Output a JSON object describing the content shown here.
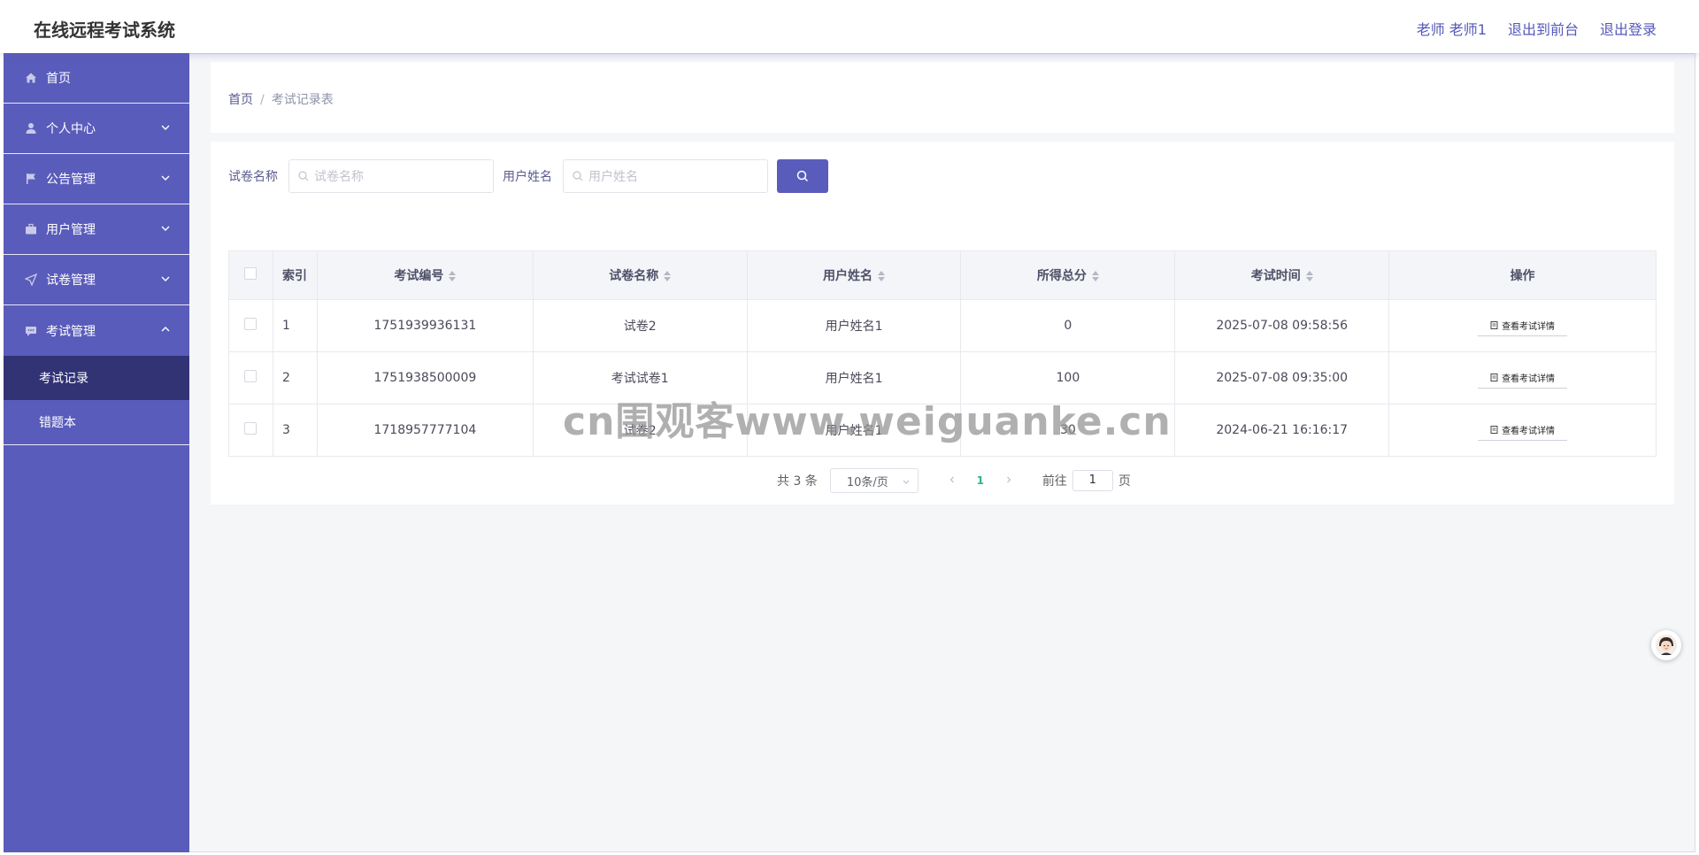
{
  "header": {
    "title": "在线远程考试系统",
    "user_label": "老师 老师1",
    "back_front": "退出到前台",
    "logout": "退出登录"
  },
  "sidebar": {
    "items": [
      {
        "label": "首页",
        "icon": "home-icon"
      },
      {
        "label": "个人中心",
        "icon": "user-icon"
      },
      {
        "label": "公告管理",
        "icon": "flag-icon"
      },
      {
        "label": "用户管理",
        "icon": "briefcase-icon"
      },
      {
        "label": "试卷管理",
        "icon": "send-icon"
      },
      {
        "label": "考试管理",
        "icon": "chat-icon"
      }
    ],
    "sub_items": [
      {
        "label": "考试记录",
        "active": true
      },
      {
        "label": "错题本",
        "active": false
      }
    ]
  },
  "breadcrumb": {
    "home": "首页",
    "separator": "/",
    "current": "考试记录表"
  },
  "search": {
    "paper_label": "试卷名称",
    "paper_placeholder": "试卷名称",
    "user_label": "用户姓名",
    "user_placeholder": "用户姓名"
  },
  "table": {
    "headers": {
      "index": "索引",
      "exam_no": "考试编号",
      "paper": "试卷名称",
      "user": "用户姓名",
      "score": "所得总分",
      "time": "考试时间",
      "action": "操作"
    },
    "rows": [
      {
        "index": "1",
        "exam_no": "1751939936131",
        "paper": "试卷2",
        "user": "用户姓名1",
        "score": "0",
        "time": "2025-07-08 09:58:56",
        "action": "查看考试详情"
      },
      {
        "index": "2",
        "exam_no": "1751938500009",
        "paper": "考试试卷1",
        "user": "用户姓名1",
        "score": "100",
        "time": "2025-07-08 09:35:00",
        "action": "查看考试详情"
      },
      {
        "index": "3",
        "exam_no": "1718957777104",
        "paper": "试卷2",
        "user": "用户姓名1",
        "score": "30",
        "time": "2024-06-21 16:16:17",
        "action": "查看考试详情"
      }
    ]
  },
  "pagination": {
    "total": "共 3 条",
    "page_size": "10条/页",
    "current_page": "1",
    "goto_label": "前往",
    "goto_value": "1",
    "page_suffix": "页"
  },
  "watermark": "cn围观客www.weiguanke.cn",
  "colors": {
    "primary": "#5a5cbb",
    "active_sub": "#323375",
    "page_num": "#2db87a"
  }
}
